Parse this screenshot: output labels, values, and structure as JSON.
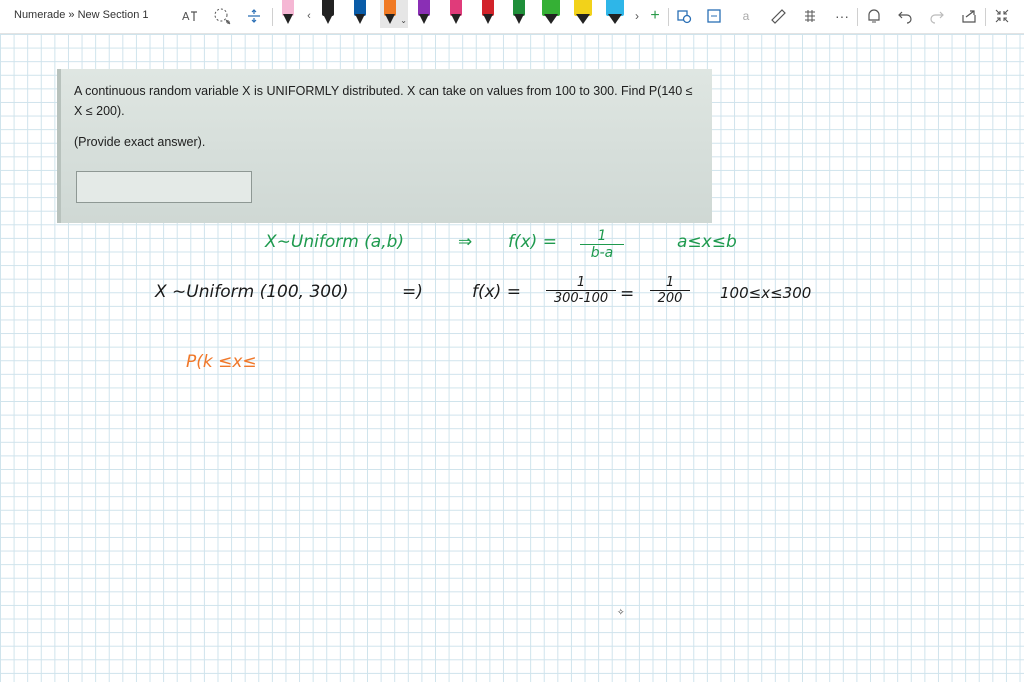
{
  "app": {
    "breadcrumb": "Numerade » New Section 1"
  },
  "toolbar": {
    "pen_colors": [
      "#f5b7d4",
      "#222222",
      "#0a5ca8",
      "#f07a24",
      "#8a2fb5",
      "#e03b7a",
      "#d2232a",
      "#1f8f3a",
      "#35b035",
      "#f2d21a",
      "#2eb6e8"
    ]
  },
  "problem": {
    "question": "A continuous random variable X is UNIFORMLY distributed. X can take on values from 100 to 300. Find P(140 ≤ X ≤ 200).",
    "hint": "(Provide exact answer).",
    "answer_value": ""
  },
  "handwriting": {
    "line1_left": "X∼Uniform (a,b)",
    "line1_arrow": "⇒",
    "line1_fx": "f(x) =",
    "line1_num": "1",
    "line1_den": "b-a",
    "line1_range": "a≤x≤b",
    "line2_left": "X ∼Uniform (100, 300)",
    "line2_arrow": "=)",
    "line2_fx": "f(x) =",
    "line2_num": "1",
    "line2_den": "300-100",
    "line2_eq": "=",
    "line2_num2": "1",
    "line2_den2": "200",
    "line2_range": "100≤x≤300",
    "line3_partial": "P(k ≤x≤"
  },
  "colors": {
    "green_ink": "#1f9a4e",
    "black_ink": "#1a1a1a",
    "orange_ink": "#f0782a"
  }
}
